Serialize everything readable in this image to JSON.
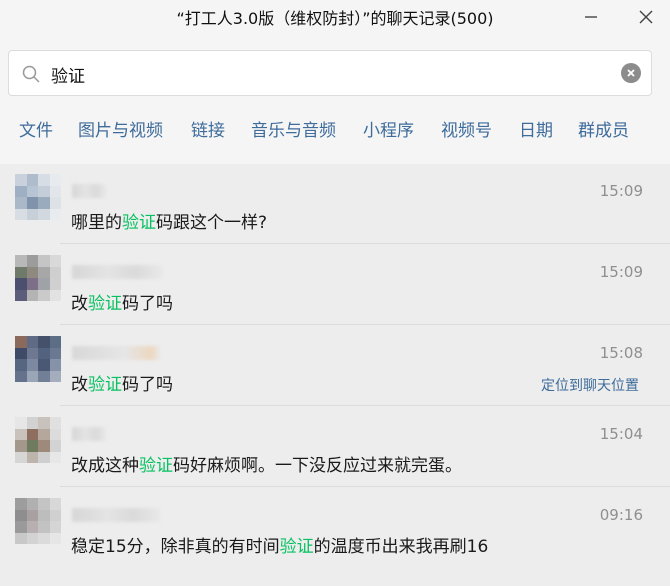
{
  "window": {
    "title": "“打工人3.0版（维权防封）”的聊天记录(500)"
  },
  "search": {
    "value": "验证",
    "placeholder": "搜索"
  },
  "filters": [
    "文件",
    "图片与视频",
    "链接",
    "音乐与音频",
    "小程序",
    "视频号",
    "日期",
    "群成员"
  ],
  "messages": [
    {
      "time": "15:09",
      "before": "哪里的",
      "keyword": "验证",
      "after": "码跟这个一样?"
    },
    {
      "time": "15:09",
      "before": "改",
      "keyword": "验证",
      "after": "码了吗"
    },
    {
      "time": "15:08",
      "before": "改",
      "keyword": "验证",
      "after": "码了吗",
      "locate": "定位到聊天位置"
    },
    {
      "time": "15:04",
      "before": "改成这种",
      "keyword": "验证",
      "after": "码好麻烦啊。一下没反应过来就完蛋。"
    },
    {
      "time": "09:16",
      "before": "稳定15分，除非真的有时间",
      "keyword": "验证",
      "after": "的温度币出来我再刷16"
    }
  ],
  "colors": {
    "highlight": "#07c160",
    "link": "#3e6c9b",
    "background": "#ededed"
  }
}
